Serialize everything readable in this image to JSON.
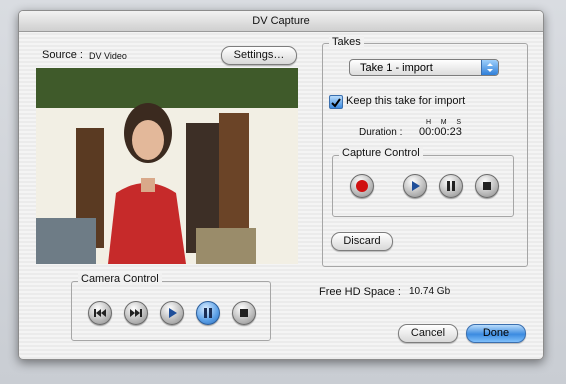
{
  "window": {
    "title": "DV Capture"
  },
  "source": {
    "label": "Source :",
    "value": "DV Video"
  },
  "settings_button": "Settings…",
  "takes": {
    "title": "Takes",
    "selected_take": "Take 1 - import",
    "keep_label": "Keep this take for import",
    "keep_checked": true,
    "duration_label": "Duration :",
    "duration_units": "H     M     S",
    "duration_value": "00:00:23",
    "capture_control_title": "Capture Control",
    "discard_label": "Discard"
  },
  "camera_control": {
    "title": "Camera Control"
  },
  "free_space": {
    "label": "Free HD Space :",
    "value": "10.74 Gb"
  },
  "footer": {
    "cancel_label": "Cancel",
    "done_label": "Done"
  },
  "colors": {
    "record": "#d01010",
    "accent": "#3c8be0"
  }
}
